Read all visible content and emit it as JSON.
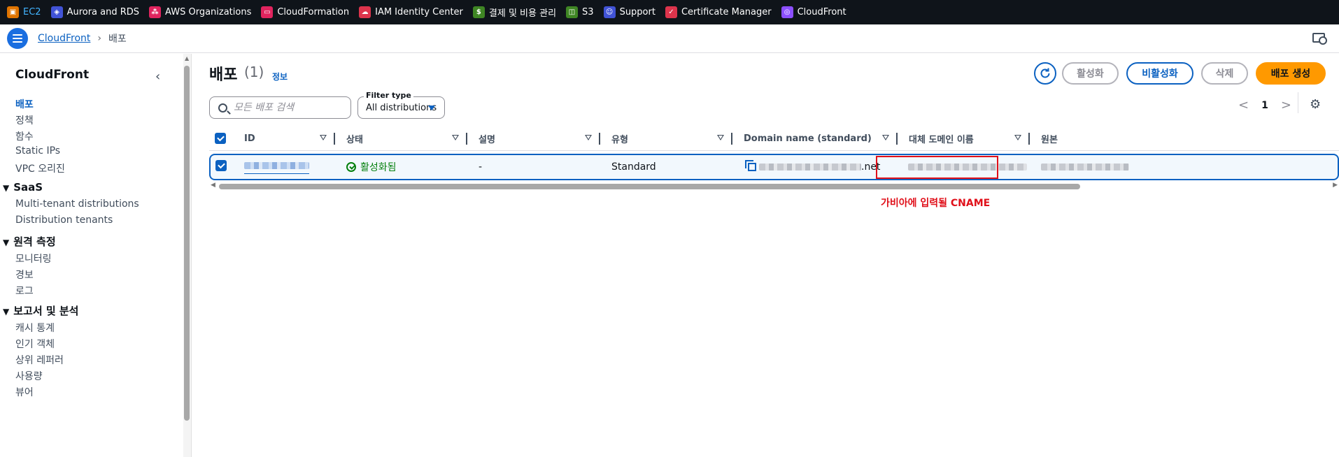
{
  "favorites": [
    {
      "label": "EC2",
      "icon": "ec2-icon",
      "color": "#e07400",
      "active": true
    },
    {
      "label": "Aurora and RDS",
      "icon": "rds-icon",
      "color": "#4153d6"
    },
    {
      "label": "AWS Organizations",
      "icon": "organizations-icon",
      "color": "#e0245e"
    },
    {
      "label": "CloudFormation",
      "icon": "cloudformation-icon",
      "color": "#e0245e"
    },
    {
      "label": "IAM Identity Center",
      "icon": "iam-identity-center-icon",
      "color": "#dd344c"
    },
    {
      "label": "결제 및 비용 관리",
      "icon": "billing-icon",
      "color": "#3f8624"
    },
    {
      "label": "S3",
      "icon": "s3-icon",
      "color": "#3f8624"
    },
    {
      "label": "Support",
      "icon": "support-icon",
      "color": "#4153d6"
    },
    {
      "label": "Certificate Manager",
      "icon": "certificate-manager-icon",
      "color": "#dd344c"
    },
    {
      "label": "CloudFront",
      "icon": "cloudfront-icon",
      "color": "#8c4fff"
    }
  ],
  "breadcrumb": {
    "parent": "CloudFront",
    "current": "배포"
  },
  "sidebar": {
    "title": "CloudFront",
    "items": [
      {
        "label": "배포",
        "active": true
      },
      {
        "label": "정책"
      },
      {
        "label": "함수"
      },
      {
        "label": "Static IPs"
      },
      {
        "label": "VPC 오리진"
      }
    ],
    "groups": [
      {
        "label": "SaaS",
        "items": [
          "Multi-tenant distributions",
          "Distribution tenants"
        ]
      },
      {
        "label": "원격 측정",
        "items": [
          "모니터링",
          "경보",
          "로그"
        ]
      },
      {
        "label": "보고서 및 분석",
        "items": [
          "캐시 통계",
          "인기 객체",
          "상위 레퍼러",
          "사용량",
          "뷰어"
        ]
      }
    ]
  },
  "page": {
    "title": "배포",
    "count": "(1)",
    "info": "정보"
  },
  "actions": {
    "enable": "활성화",
    "disable": "비활성화",
    "delete": "삭제",
    "create": "배포 생성"
  },
  "search": {
    "placeholder": "모든 배포 검색"
  },
  "filter": {
    "label": "Filter type",
    "value": "All distributions"
  },
  "pagination": {
    "prev": "<",
    "page": "1",
    "next": ">"
  },
  "table": {
    "columns": [
      "ID",
      "상태",
      "설명",
      "유형",
      "Domain name (standard)",
      "대체 도메인 이름",
      "원본"
    ],
    "row": {
      "status": "활성화됨",
      "description": "-",
      "type": "Standard",
      "domain_suffix": ".net"
    }
  },
  "annotation": "가비아에 입력될 CNAME",
  "colors": {
    "accent": "#0b61c1",
    "primary": "#ff9900",
    "success": "#037f0c",
    "highlight": "#e0101a",
    "topbar": "#0f141a"
  }
}
